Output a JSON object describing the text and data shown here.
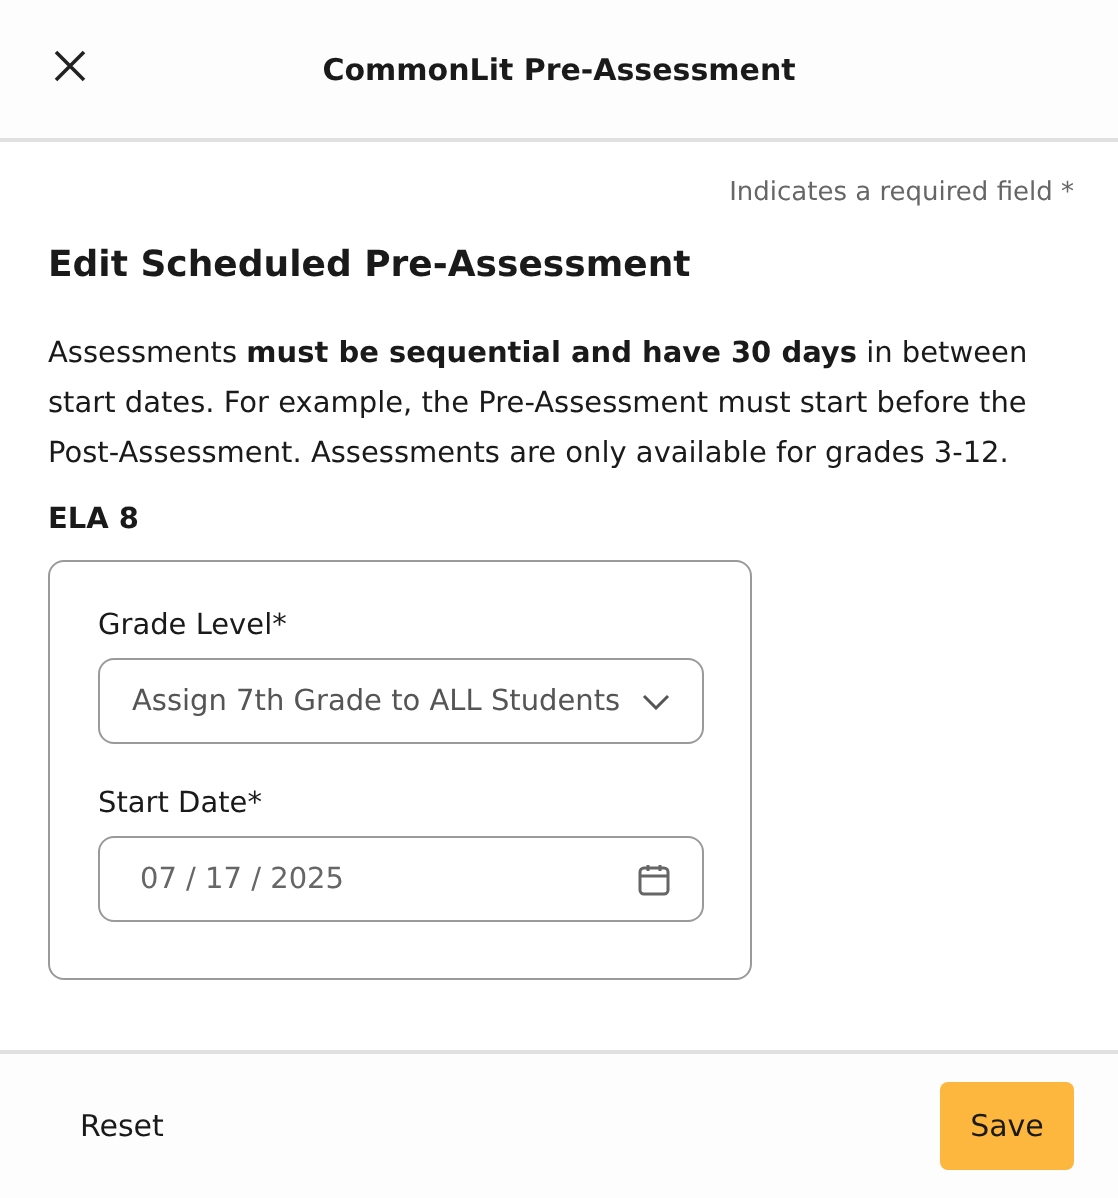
{
  "header": {
    "title": "CommonLit Pre-Assessment"
  },
  "required_note": "Indicates a required field *",
  "heading": "Edit Scheduled Pre-Assessment",
  "description": "Assessments **must be sequential and have 30 days** in between start dates. For example, the Pre-Assessment must start before the Post-Assessment. Assessments are only available for grades 3-12.",
  "class_name": "ELA 8",
  "fields": [
    {
      "kind": "select",
      "label": "Grade Level",
      "required_mark": "*",
      "value": "Assign 7th Grade to ALL Students"
    },
    {
      "kind": "date",
      "label": "Start Date",
      "required_mark": "*",
      "value": "07 / 17 / 2025"
    }
  ],
  "footer": {
    "reset": "Reset",
    "save": "Save"
  }
}
